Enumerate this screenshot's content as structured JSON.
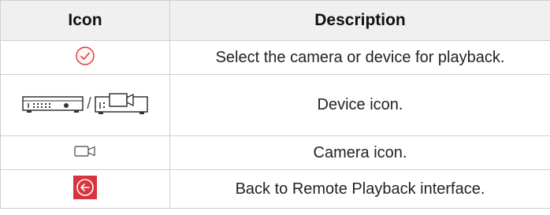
{
  "table": {
    "headers": {
      "icon": "Icon",
      "description": "Description"
    },
    "rows": [
      {
        "icon": "check-circle-icon",
        "description": "Select the camera or device for playback."
      },
      {
        "icon": "device-icon",
        "icon_separator": "/",
        "description": "Device icon."
      },
      {
        "icon": "camera-icon",
        "description": "Camera icon."
      },
      {
        "icon": "back-arrow-icon",
        "description": "Back to Remote Playback interface."
      }
    ]
  },
  "colors": {
    "accent_red": "#d9333f",
    "header_bg": "#f0f0f0",
    "border": "#cfcfcf"
  }
}
